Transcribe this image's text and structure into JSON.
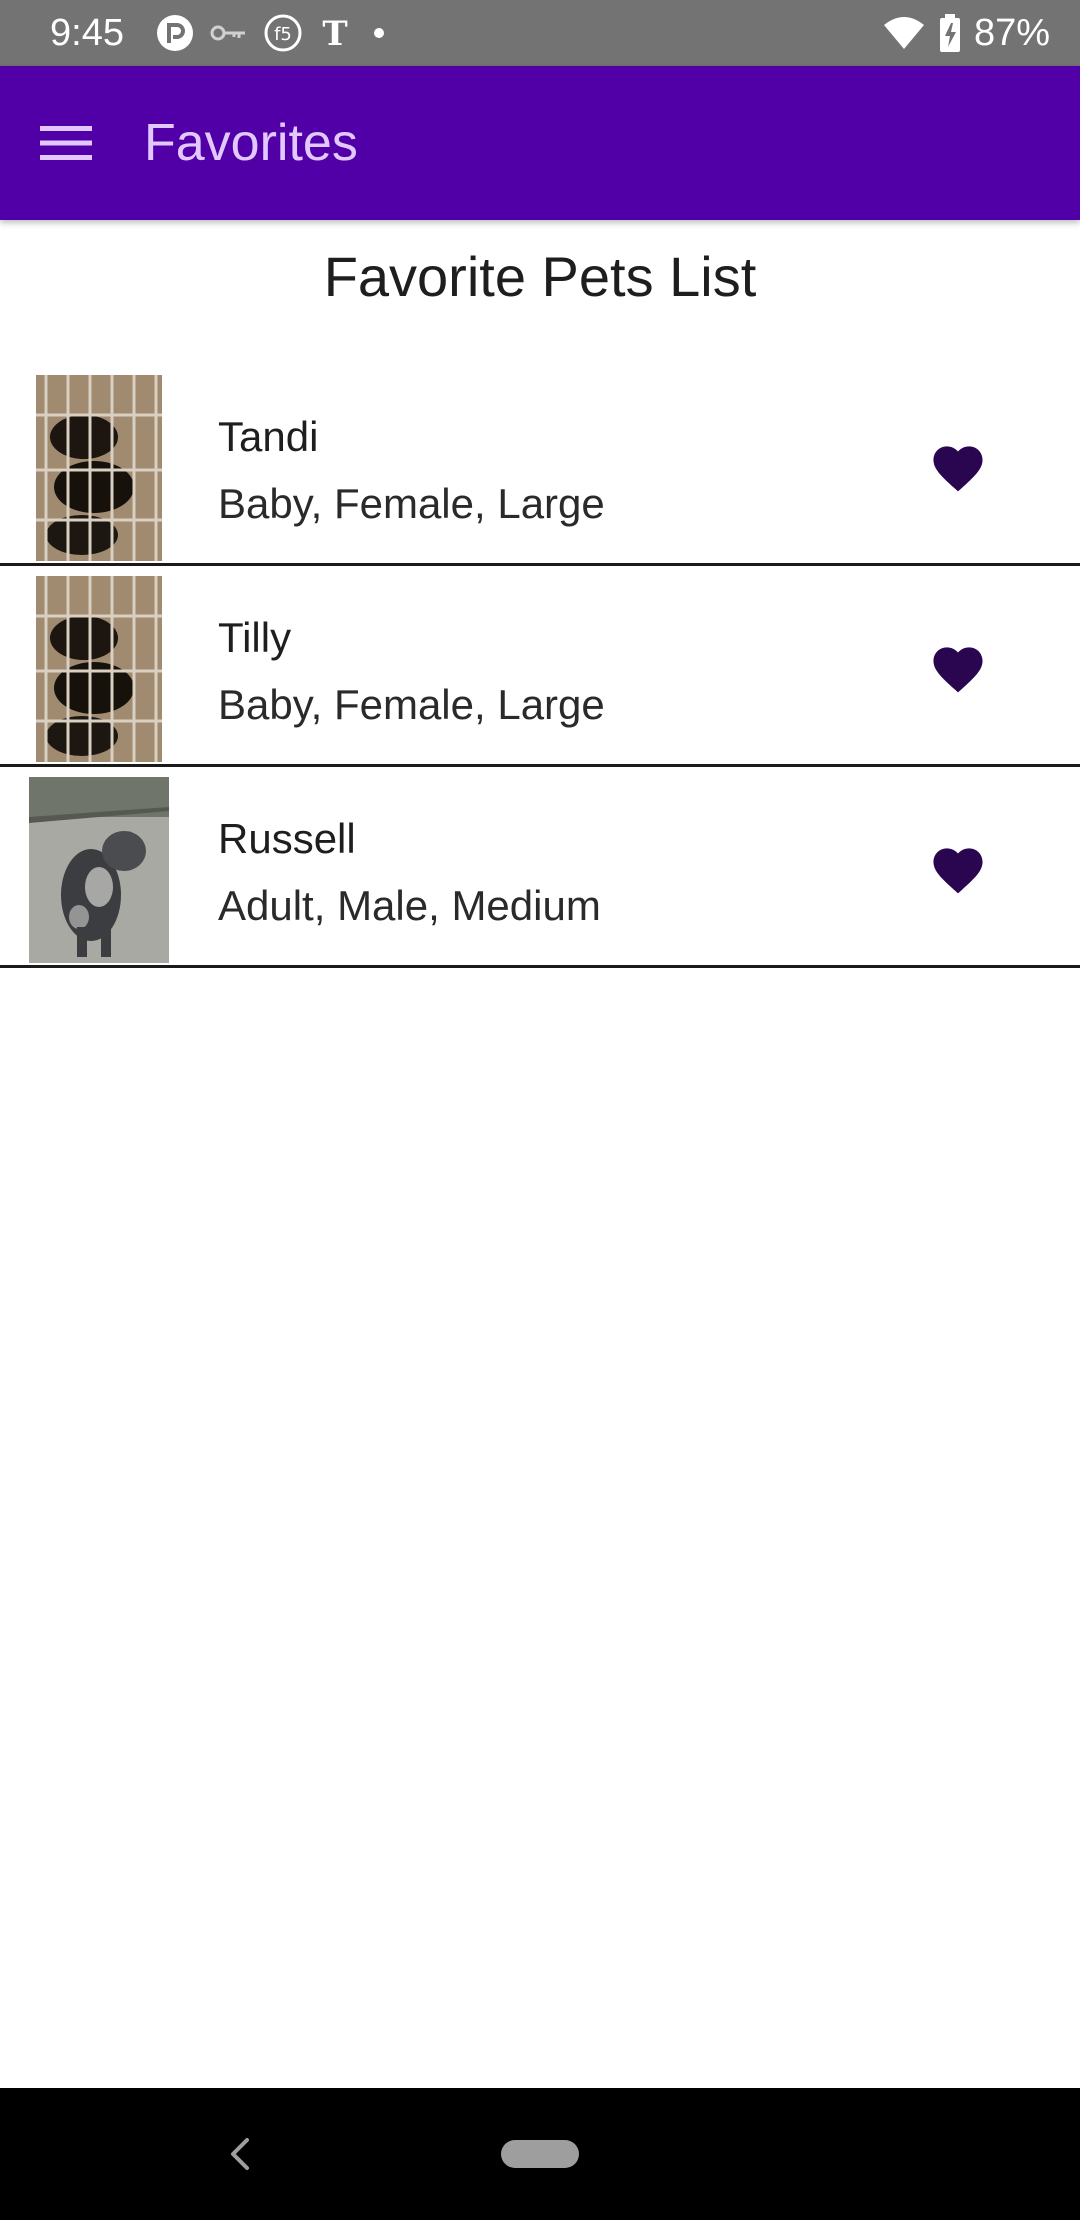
{
  "status_bar": {
    "time": "9:45",
    "battery_percent": "87%",
    "icons_left": [
      "pocket-casts-icon",
      "key-icon",
      "f5-icon",
      "nytimes-icon",
      "notification-dot-icon"
    ],
    "icons_right": [
      "wifi-icon",
      "battery-charging-icon"
    ]
  },
  "app_bar": {
    "title": "Favorites",
    "menu_icon": "hamburger-menu-icon",
    "background_color": "#5000a6",
    "title_color": "#e2c8ff"
  },
  "page": {
    "title": "Favorite Pets List"
  },
  "pets": [
    {
      "name": "Tandi",
      "details": "Baby, Female, Large",
      "favorited": true,
      "photo": "puppies-in-crate-photo"
    },
    {
      "name": "Tilly",
      "details": "Baby, Female, Large",
      "favorited": true,
      "photo": "puppies-in-crate-photo"
    },
    {
      "name": "Russell",
      "details": "Adult, Male, Medium",
      "favorited": true,
      "photo": "merle-dog-sitting-photo"
    }
  ],
  "heart_color": "#2a0650",
  "nav_bar": {
    "back_icon": "back-chevron-icon",
    "home_icon": "home-pill-icon"
  }
}
